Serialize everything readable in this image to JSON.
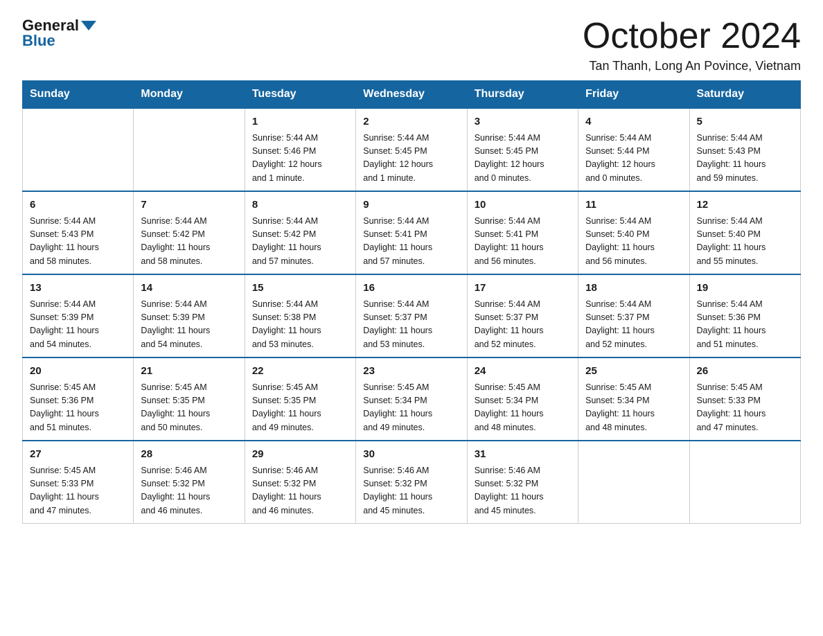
{
  "header": {
    "logo_general": "General",
    "logo_blue": "Blue",
    "month_title": "October 2024",
    "location": "Tan Thanh, Long An Povince, Vietnam"
  },
  "weekdays": [
    "Sunday",
    "Monday",
    "Tuesday",
    "Wednesday",
    "Thursday",
    "Friday",
    "Saturday"
  ],
  "weeks": [
    [
      {
        "day": "",
        "info": ""
      },
      {
        "day": "",
        "info": ""
      },
      {
        "day": "1",
        "info": "Sunrise: 5:44 AM\nSunset: 5:46 PM\nDaylight: 12 hours\nand 1 minute."
      },
      {
        "day": "2",
        "info": "Sunrise: 5:44 AM\nSunset: 5:45 PM\nDaylight: 12 hours\nand 1 minute."
      },
      {
        "day": "3",
        "info": "Sunrise: 5:44 AM\nSunset: 5:45 PM\nDaylight: 12 hours\nand 0 minutes."
      },
      {
        "day": "4",
        "info": "Sunrise: 5:44 AM\nSunset: 5:44 PM\nDaylight: 12 hours\nand 0 minutes."
      },
      {
        "day": "5",
        "info": "Sunrise: 5:44 AM\nSunset: 5:43 PM\nDaylight: 11 hours\nand 59 minutes."
      }
    ],
    [
      {
        "day": "6",
        "info": "Sunrise: 5:44 AM\nSunset: 5:43 PM\nDaylight: 11 hours\nand 58 minutes."
      },
      {
        "day": "7",
        "info": "Sunrise: 5:44 AM\nSunset: 5:42 PM\nDaylight: 11 hours\nand 58 minutes."
      },
      {
        "day": "8",
        "info": "Sunrise: 5:44 AM\nSunset: 5:42 PM\nDaylight: 11 hours\nand 57 minutes."
      },
      {
        "day": "9",
        "info": "Sunrise: 5:44 AM\nSunset: 5:41 PM\nDaylight: 11 hours\nand 57 minutes."
      },
      {
        "day": "10",
        "info": "Sunrise: 5:44 AM\nSunset: 5:41 PM\nDaylight: 11 hours\nand 56 minutes."
      },
      {
        "day": "11",
        "info": "Sunrise: 5:44 AM\nSunset: 5:40 PM\nDaylight: 11 hours\nand 56 minutes."
      },
      {
        "day": "12",
        "info": "Sunrise: 5:44 AM\nSunset: 5:40 PM\nDaylight: 11 hours\nand 55 minutes."
      }
    ],
    [
      {
        "day": "13",
        "info": "Sunrise: 5:44 AM\nSunset: 5:39 PM\nDaylight: 11 hours\nand 54 minutes."
      },
      {
        "day": "14",
        "info": "Sunrise: 5:44 AM\nSunset: 5:39 PM\nDaylight: 11 hours\nand 54 minutes."
      },
      {
        "day": "15",
        "info": "Sunrise: 5:44 AM\nSunset: 5:38 PM\nDaylight: 11 hours\nand 53 minutes."
      },
      {
        "day": "16",
        "info": "Sunrise: 5:44 AM\nSunset: 5:37 PM\nDaylight: 11 hours\nand 53 minutes."
      },
      {
        "day": "17",
        "info": "Sunrise: 5:44 AM\nSunset: 5:37 PM\nDaylight: 11 hours\nand 52 minutes."
      },
      {
        "day": "18",
        "info": "Sunrise: 5:44 AM\nSunset: 5:37 PM\nDaylight: 11 hours\nand 52 minutes."
      },
      {
        "day": "19",
        "info": "Sunrise: 5:44 AM\nSunset: 5:36 PM\nDaylight: 11 hours\nand 51 minutes."
      }
    ],
    [
      {
        "day": "20",
        "info": "Sunrise: 5:45 AM\nSunset: 5:36 PM\nDaylight: 11 hours\nand 51 minutes."
      },
      {
        "day": "21",
        "info": "Sunrise: 5:45 AM\nSunset: 5:35 PM\nDaylight: 11 hours\nand 50 minutes."
      },
      {
        "day": "22",
        "info": "Sunrise: 5:45 AM\nSunset: 5:35 PM\nDaylight: 11 hours\nand 49 minutes."
      },
      {
        "day": "23",
        "info": "Sunrise: 5:45 AM\nSunset: 5:34 PM\nDaylight: 11 hours\nand 49 minutes."
      },
      {
        "day": "24",
        "info": "Sunrise: 5:45 AM\nSunset: 5:34 PM\nDaylight: 11 hours\nand 48 minutes."
      },
      {
        "day": "25",
        "info": "Sunrise: 5:45 AM\nSunset: 5:34 PM\nDaylight: 11 hours\nand 48 minutes."
      },
      {
        "day": "26",
        "info": "Sunrise: 5:45 AM\nSunset: 5:33 PM\nDaylight: 11 hours\nand 47 minutes."
      }
    ],
    [
      {
        "day": "27",
        "info": "Sunrise: 5:45 AM\nSunset: 5:33 PM\nDaylight: 11 hours\nand 47 minutes."
      },
      {
        "day": "28",
        "info": "Sunrise: 5:46 AM\nSunset: 5:32 PM\nDaylight: 11 hours\nand 46 minutes."
      },
      {
        "day": "29",
        "info": "Sunrise: 5:46 AM\nSunset: 5:32 PM\nDaylight: 11 hours\nand 46 minutes."
      },
      {
        "day": "30",
        "info": "Sunrise: 5:46 AM\nSunset: 5:32 PM\nDaylight: 11 hours\nand 45 minutes."
      },
      {
        "day": "31",
        "info": "Sunrise: 5:46 AM\nSunset: 5:32 PM\nDaylight: 11 hours\nand 45 minutes."
      },
      {
        "day": "",
        "info": ""
      },
      {
        "day": "",
        "info": ""
      }
    ]
  ]
}
